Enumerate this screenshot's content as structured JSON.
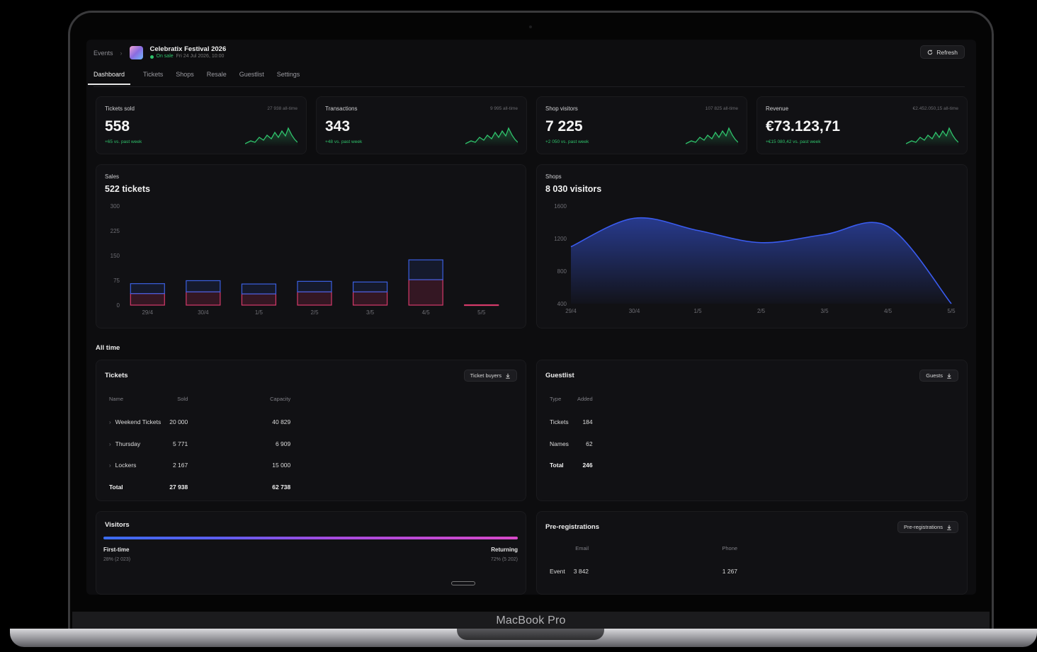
{
  "device_label": "MacBook Pro",
  "breadcrumb": {
    "root": "Events",
    "event_title": "Celebratix Festival 2026",
    "status": "On sale",
    "date": "Fri 24 Jul 2026, 10:00"
  },
  "refresh_label": "Refresh",
  "tabs": [
    "Dashboard",
    "Tickets",
    "Shops",
    "Resale",
    "Guestlist",
    "Settings"
  ],
  "kpis": [
    {
      "label": "Tickets sold",
      "all_time": "27 938 all-time",
      "value": "558",
      "delta": "+65 vs. past week"
    },
    {
      "label": "Transactions",
      "all_time": "9 995 all-time",
      "value": "343",
      "delta": "+48 vs. past week"
    },
    {
      "label": "Shop visitors",
      "all_time": "107 825 all-time",
      "value": "7 225",
      "delta": "+2 050 vs. past week"
    },
    {
      "label": "Revenue",
      "all_time": "€2.452.050,15 all-time",
      "value": "€73.123,71",
      "delta": "+€15 080,42 vs. past week"
    }
  ],
  "sales": {
    "label": "Sales",
    "value": "522 tickets"
  },
  "shops": {
    "label": "Shops",
    "value": "8 030 visitors"
  },
  "chart_data": [
    {
      "type": "bar",
      "categories": [
        "29/4",
        "30/4",
        "1/5",
        "2/5",
        "3/5",
        "4/5",
        "5/5"
      ],
      "series": [
        {
          "values": [
            35,
            40,
            34,
            40,
            40,
            77,
            1
          ]
        },
        {
          "values": [
            30,
            34,
            30,
            32,
            30,
            60,
            0
          ]
        }
      ],
      "yticks": [
        "300",
        "225",
        "150",
        "75",
        "0"
      ],
      "ylim": [
        0,
        300
      ],
      "colors": [
        "#d63a6a",
        "#3b5fe0"
      ]
    },
    {
      "type": "area",
      "x": [
        "29/4",
        "30/4",
        "1/5",
        "2/5",
        "3/5",
        "4/5",
        "5/5"
      ],
      "values": [
        1100,
        1450,
        1300,
        1150,
        1250,
        1350,
        400
      ],
      "yticks": [
        "1600",
        "1200",
        "800",
        "400"
      ],
      "ylim": [
        400,
        1600
      ],
      "color": "#3a5cf0"
    }
  ],
  "all_time_label": "All time",
  "tickets_table": {
    "title": "Tickets",
    "button": "Ticket buyers",
    "headers": [
      "Name",
      "Sold",
      "Capacity"
    ],
    "rows": [
      [
        "Weekend Tickets",
        "20 000",
        "40 829"
      ],
      [
        "Thursday",
        "5 771",
        "6 909"
      ],
      [
        "Lockers",
        "2 167",
        "15 000"
      ]
    ],
    "total": [
      "Total",
      "27 938",
      "62 738"
    ]
  },
  "guestlist": {
    "title": "Guestlist",
    "button": "Guests",
    "headers": [
      "Type",
      "Added"
    ],
    "rows": [
      [
        "Tickets",
        "184"
      ],
      [
        "Names",
        "62"
      ]
    ],
    "total": [
      "Total",
      "246"
    ]
  },
  "visitors": {
    "title": "Visitors",
    "first_label": "First-time",
    "first_value": "28% (2 023)",
    "returning_label": "Returning",
    "returning_value": "72% (5 202)",
    "first_fraction": 0.28
  },
  "preregistrations": {
    "title": "Pre-registrations",
    "button": "Pre-registrations",
    "headers": [
      "",
      "Email",
      "Phone"
    ],
    "rows": [
      [
        "Event",
        "3 842",
        "1 267"
      ]
    ]
  }
}
